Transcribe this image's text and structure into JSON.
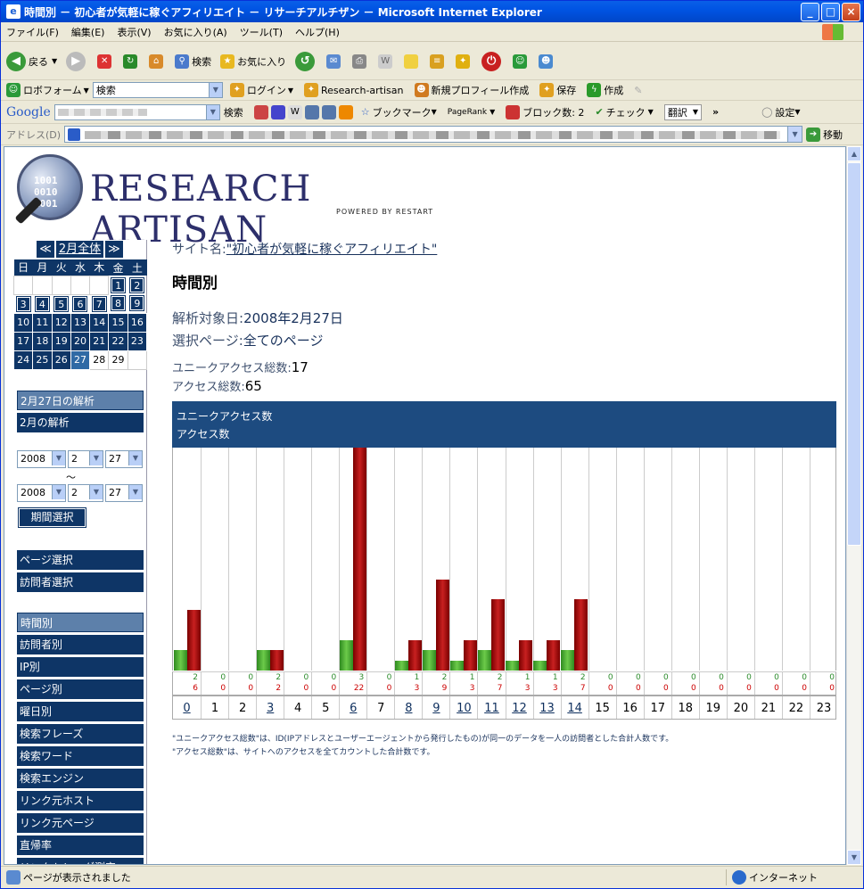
{
  "window": {
    "title": "時間別 － 初心者が気軽に稼ぐアフィリエイト － リサーチアルチザン － Microsoft Internet Explorer"
  },
  "menu": [
    "ファイル(F)",
    "編集(E)",
    "表示(V)",
    "お気に入り(A)",
    "ツール(T)",
    "ヘルプ(H)"
  ],
  "toolbar": {
    "back": "戻る",
    "search": "検索",
    "favorites": "お気に入り"
  },
  "linkbar": {
    "robo": "ロボフォーム",
    "search_value": "検索",
    "login": "ログイン",
    "research": "Research-artisan",
    "newprofile": "新規プロフィール作成",
    "save": "保存",
    "create": "作成"
  },
  "google_bar": {
    "logo": "Google",
    "search": "検索",
    "bookmark": "ブックマーク",
    "pagerank": "PageRank",
    "blocked": "ブロック数: 2",
    "check": "チェック",
    "translate": "翻訳",
    "settings": "設定"
  },
  "address": {
    "label": "アドレス(D)",
    "go": "移動"
  },
  "status": {
    "text": "ページが表示されました",
    "zone": "インターネット"
  },
  "logo": {
    "title": "RESEARCH ARTISAN",
    "sub": "POWERED BY RESTART",
    "bin": "1001\n0010\n1001"
  },
  "calendar": {
    "prev": "≪",
    "month": "2月全体",
    "next": "≫",
    "weekdays": [
      "日",
      "月",
      "火",
      "水",
      "木",
      "金",
      "土"
    ]
  },
  "sidebar": {
    "day_analysis": "2月27日の解析",
    "month_analysis": "2月の解析",
    "from": {
      "year": "2008",
      "month": "2",
      "day": "27"
    },
    "to": {
      "year": "2008",
      "month": "2",
      "day": "27"
    },
    "tilde": "～",
    "period_button": "期間選択",
    "page_select": "ページ選択",
    "visitor_select": "訪問者選択",
    "nav": [
      "時間別",
      "訪問者別",
      "IP別",
      "ページ別",
      "曜日別",
      "検索フレーズ",
      "検索ワード",
      "検索エンジン",
      "リンク元ホスト",
      "リンク元ページ",
      "直帰率",
      "リンクトレーダ測定"
    ]
  },
  "main": {
    "site_label": "サイト名:",
    "site_name": "\"初心者が気軽に稼ぐアフィリエイト\"",
    "heading": "時間別",
    "date_label": "解析対象日:",
    "date_value": "2008年2月27日",
    "page_label": "選択ページ:",
    "page_value": "全てのページ",
    "unique_label": "ユニークアクセス総数:",
    "unique_value": "17",
    "total_label": "アクセス総数:",
    "total_value": "65",
    "legend_unique": "ユニークアクセス数",
    "legend_total": "アクセス数",
    "note1": "\"ユニークアクセス総数\"は、ID(IPアドレスとユーザーエージェントから発行したもの)が同一のデータを一人の訪問者とした合計人数です。",
    "note2": "\"アクセス総数\"は、サイトへのアクセスを全てカウントした合計数です。"
  },
  "chart_data": {
    "type": "bar",
    "categories": [
      "0",
      "1",
      "2",
      "3",
      "4",
      "5",
      "6",
      "7",
      "8",
      "9",
      "10",
      "11",
      "12",
      "13",
      "14",
      "15",
      "16",
      "17",
      "18",
      "19",
      "20",
      "21",
      "22",
      "23"
    ],
    "series": [
      {
        "name": "ユニークアクセス数",
        "values": [
          2,
          0,
          0,
          2,
          0,
          0,
          3,
          0,
          1,
          2,
          1,
          2,
          1,
          1,
          2,
          0,
          0,
          0,
          0,
          0,
          0,
          0,
          0,
          0
        ]
      },
      {
        "name": "アクセス数",
        "values": [
          6,
          0,
          0,
          2,
          0,
          0,
          22,
          0,
          3,
          9,
          3,
          7,
          3,
          3,
          7,
          0,
          0,
          0,
          0,
          0,
          0,
          0,
          0,
          0
        ]
      }
    ],
    "linked": [
      0,
      3,
      6,
      8,
      9,
      10,
      11,
      12,
      13,
      14
    ],
    "ylim": [
      0,
      22
    ],
    "colors": {
      "unique": "#3a9a2a",
      "total": "#a80c0c"
    }
  }
}
